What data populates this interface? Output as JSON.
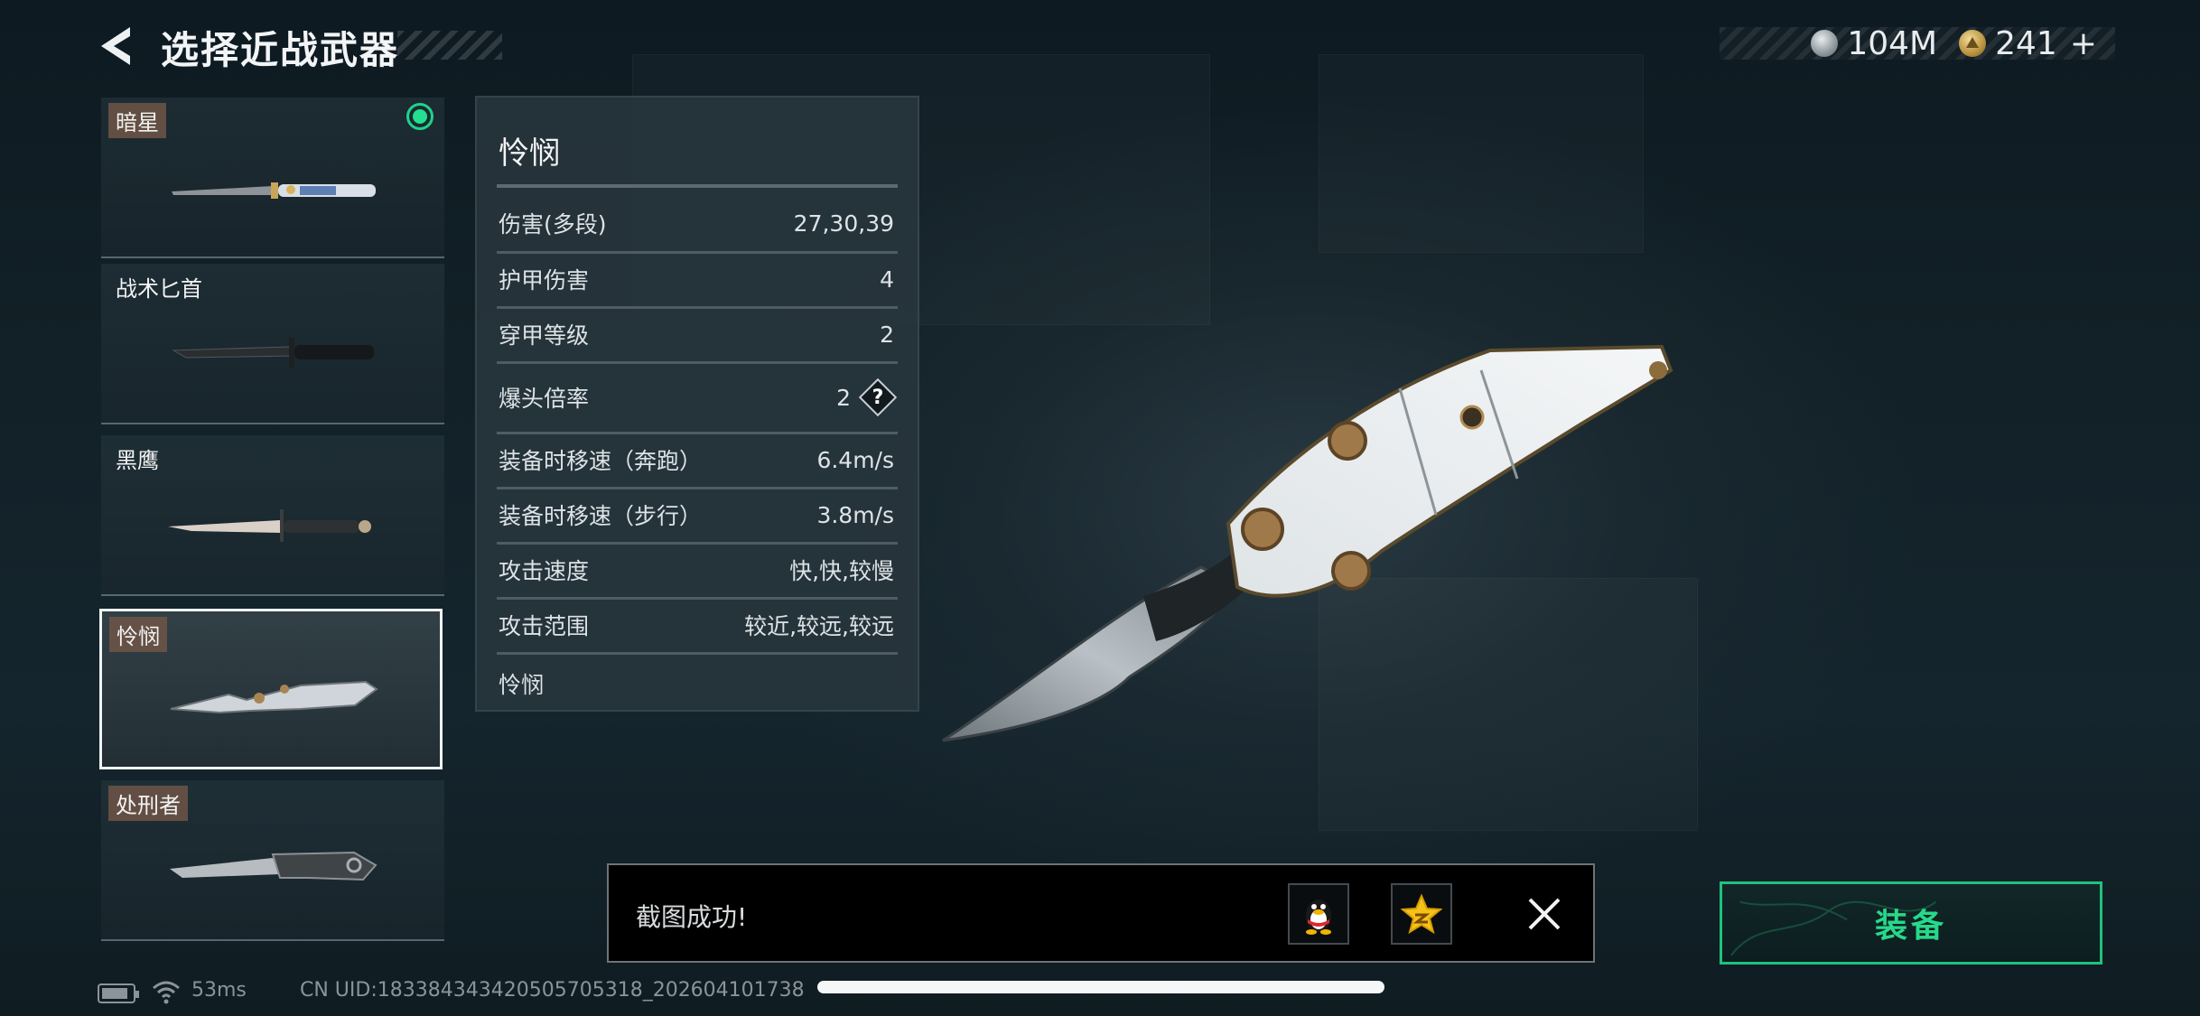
{
  "header": {
    "title": "选择近战武器"
  },
  "currency": [
    {
      "icon": "silver-coin-icon",
      "value": "104M"
    },
    {
      "icon": "gold-coin-icon",
      "value": "241",
      "add_label": "+"
    }
  ],
  "weapons": [
    {
      "name": "暗星",
      "tagged": true,
      "equipped": true,
      "selected": false
    },
    {
      "name": "战术匕首",
      "tagged": false,
      "equipped": false,
      "selected": false
    },
    {
      "name": "黑鹰",
      "tagged": false,
      "equipped": false,
      "selected": false
    },
    {
      "name": "怜悯",
      "tagged": true,
      "equipped": false,
      "selected": true
    },
    {
      "name": "处刑者",
      "tagged": true,
      "equipped": false,
      "selected": false
    }
  ],
  "details": {
    "title": "怜悯",
    "stats": [
      {
        "label": "伤害(多段)",
        "value": "27,30,39"
      },
      {
        "label": "护甲伤害",
        "value": "4"
      },
      {
        "label": "穿甲等级",
        "value": "2"
      },
      {
        "label": "爆头倍率",
        "value": "2",
        "help": "?"
      },
      {
        "label": "装备时移速（奔跑）",
        "value": "6.4m/s"
      },
      {
        "label": "装备时移速（步行）",
        "value": "3.8m/s"
      },
      {
        "label": "攻击速度",
        "value": "快,快,较慢"
      },
      {
        "label": "攻击范围",
        "value": "较近,较远,较远"
      }
    ],
    "footer": "怜悯"
  },
  "toast": {
    "message": "截图成功!",
    "share_qq_icon": "qq-penguin-icon",
    "share_qzone_icon": "qzone-star-icon"
  },
  "equip_button": {
    "label": "装备"
  },
  "status_bar": {
    "ping": "53ms",
    "uid": "CN UID:183384343420505705318_202604101738"
  },
  "colors": {
    "accent": "#22e08f",
    "panel": "#28363e",
    "background": "#132229"
  }
}
